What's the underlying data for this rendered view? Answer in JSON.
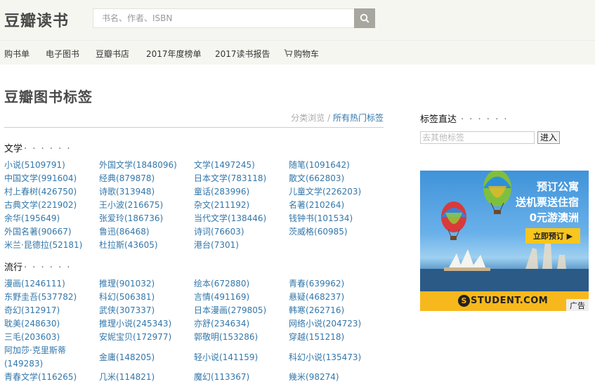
{
  "header": {
    "logo": "豆瓣读书",
    "search_placeholder": "书名、作者、ISBN"
  },
  "nav": [
    {
      "label": "购书单"
    },
    {
      "label": "电子图书"
    },
    {
      "label": "豆瓣书店"
    },
    {
      "label": "2017年度榜单"
    },
    {
      "label": "2017读书报告"
    },
    {
      "label": "购物车",
      "icon": "cart-icon"
    }
  ],
  "main": {
    "title": "豆瓣图书标签",
    "browse_link": "分类浏览",
    "separator": " / ",
    "hot_link": "所有热门标签",
    "categories": [
      {
        "name": "文学",
        "dots": "· · · · · ·",
        "tags": [
          {
            "name": "小说",
            "count": "(5109791)"
          },
          {
            "name": "外国文学",
            "count": "(1848096)"
          },
          {
            "name": "文学",
            "count": "(1497245)"
          },
          {
            "name": "随笔",
            "count": "(1091642)"
          },
          {
            "name": "中国文学",
            "count": "(991604)"
          },
          {
            "name": "经典",
            "count": "(879878)"
          },
          {
            "name": "日本文学",
            "count": "(783118)"
          },
          {
            "name": "散文",
            "count": "(662803)"
          },
          {
            "name": "村上春树",
            "count": "(426750)"
          },
          {
            "name": "诗歌",
            "count": "(313948)"
          },
          {
            "name": "童话",
            "count": "(283996)"
          },
          {
            "name": "儿童文学",
            "count": "(226203)"
          },
          {
            "name": "古典文学",
            "count": "(221902)"
          },
          {
            "name": "王小波",
            "count": "(216675)"
          },
          {
            "name": "杂文",
            "count": "(211192)"
          },
          {
            "name": "名著",
            "count": "(210264)"
          },
          {
            "name": "余华",
            "count": "(195649)"
          },
          {
            "name": "张爱玲",
            "count": "(186736)"
          },
          {
            "name": "当代文学",
            "count": "(138446)"
          },
          {
            "name": "钱钟书",
            "count": "(101534)"
          },
          {
            "name": "外国名著",
            "count": "(90667)"
          },
          {
            "name": "鲁迅",
            "count": "(86468)"
          },
          {
            "name": "诗词",
            "count": "(76603)"
          },
          {
            "name": "茨威格",
            "count": "(60985)"
          },
          {
            "name": "米兰·昆德拉",
            "count": "(52181)"
          },
          {
            "name": "杜拉斯",
            "count": "(43605)"
          },
          {
            "name": "港台",
            "count": "(7301)"
          }
        ]
      },
      {
        "name": "流行",
        "dots": "· · · · · ·",
        "tags": [
          {
            "name": "漫画",
            "count": "(1246111)"
          },
          {
            "name": "推理",
            "count": "(901032)"
          },
          {
            "name": "绘本",
            "count": "(672880)"
          },
          {
            "name": "青春",
            "count": "(639962)"
          },
          {
            "name": "东野圭吾",
            "count": "(537782)"
          },
          {
            "name": "科幻",
            "count": "(506381)"
          },
          {
            "name": "言情",
            "count": "(491169)"
          },
          {
            "name": "悬疑",
            "count": "(468237)"
          },
          {
            "name": "奇幻",
            "count": "(312917)"
          },
          {
            "name": "武侠",
            "count": "(307337)"
          },
          {
            "name": "日本漫画",
            "count": "(279805)"
          },
          {
            "name": "韩寒",
            "count": "(262716)"
          },
          {
            "name": "耽美",
            "count": "(248630)"
          },
          {
            "name": "推理小说",
            "count": "(245343)"
          },
          {
            "name": "亦舒",
            "count": "(234634)"
          },
          {
            "name": "网络小说",
            "count": "(204723)"
          },
          {
            "name": "三毛",
            "count": "(203603)"
          },
          {
            "name": "安妮宝贝",
            "count": "(172977)"
          },
          {
            "name": "郭敬明",
            "count": "(153286)"
          },
          {
            "name": "穿越",
            "count": "(151218)"
          },
          {
            "name": "阿加莎·克里斯蒂",
            "count": "(149283)"
          },
          {
            "name": "金庸",
            "count": "(148205)"
          },
          {
            "name": "轻小说",
            "count": "(141159)"
          },
          {
            "name": "科幻小说",
            "count": "(135473)"
          },
          {
            "name": "青春文学",
            "count": "(116265)"
          },
          {
            "name": "几米",
            "count": "(114821)"
          },
          {
            "name": "魔幻",
            "count": "(113367)"
          },
          {
            "name": "幾米",
            "count": "(98274)"
          }
        ]
      }
    ]
  },
  "sidebar": {
    "title": "标签直达",
    "dots": "· · · · · ·",
    "input_placeholder": "去其他标签",
    "go_label": "进入",
    "ad": {
      "line1": "预订公寓",
      "line2": "送机票送住宿",
      "line3": "0元游澳洲",
      "button": "立即预订 ▶",
      "brand": "STUDENT.COM",
      "badge": "广告"
    }
  },
  "colors": {
    "link": "#3377aa",
    "header_bg": "#f6f6f1",
    "search_button": "#a7a79f",
    "ad_yellow": "#f6b81c"
  }
}
